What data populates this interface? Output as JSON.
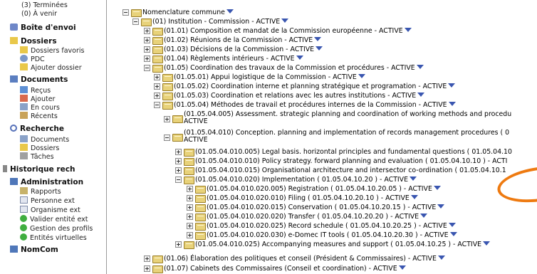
{
  "sidebar": {
    "status_lines": [
      "(3) Terminées",
      "(0) À venir"
    ],
    "boite_envoi": "Boîte d'envoi",
    "dossiers": {
      "title": "Dossiers",
      "items": [
        "Dossiers favoris",
        "PDC",
        "Ajouter dossier"
      ]
    },
    "documents": {
      "title": "Documents",
      "items": [
        "Reçus",
        "Ajouter",
        "En cours",
        "Récents"
      ]
    },
    "recherche": {
      "title": "Recherche",
      "items": [
        "Documents",
        "Dossiers",
        "Tâches"
      ]
    },
    "historique": "Historique rech",
    "administration": {
      "title": "Administration",
      "items": [
        "Rapports",
        "Personne ext",
        "Organisme ext",
        "Valider entité ext",
        "Gestion des profils",
        "Entités virtuelles"
      ]
    },
    "nomcom": "NomCom"
  },
  "tree": [
    {
      "label": "Nomenclature commune",
      "status": ""
    },
    {
      "label": "(01) Institution - Commission - ACTIVE"
    },
    {
      "label": "(01.01) Composition et mandat de la Commission européenne - ACTIVE"
    },
    {
      "label": "(01.02) Réunions de la Commission - ACTIVE"
    },
    {
      "label": "(01.03) Décisions de la Commission - ACTIVE"
    },
    {
      "label": "(01.04) Règlements intérieurs - ACTIVE"
    },
    {
      "label": "(01.05) Coordination des travaux de la Commission et procédures - ACTIVE"
    },
    {
      "label": "(01.05.01) Appui logistique de la Commission - ACTIVE"
    },
    {
      "label": "(01.05.02) Coordination interne et planning stratégique et programation - ACTIVE"
    },
    {
      "label": "(01.05.03) Coordination et relations avec les autres institutions - ACTIVE"
    },
    {
      "label": "(01.05.04) Méthodes de travail et procédures internes de la Commission - ACTIVE"
    },
    {
      "label": "(01.05.04.005) Assessment. strategic planning and coordination of working methods and procedu",
      "label2": "ACTIVE"
    },
    {
      "label": "(01.05.04.010) Conception. planning and implementation of records management procedures ( 0",
      "label2": "ACTIVE"
    },
    {
      "label": "(01.05.04.010.005) Legal basis. horizontal principles and fundamental questions ( 01.05.04.10"
    },
    {
      "label": "(01.05.04.010.010) Policy strategy. forward planning and evaluation ( 01.05.04.10.10 ) - ACTI"
    },
    {
      "label": "(01.05.04.010.015) Organisational architecture and intersector co-ordination ( 01.05.04.10.1"
    },
    {
      "label": "(01.05.04.010.020) Implementation ( 01.05.04.10.20 ) - ACTIVE"
    },
    {
      "label": "(01.05.04.010.020.005) Registration ( 01.05.04.10.20.05 ) - ACTIVE"
    },
    {
      "label": "(01.05.04.010.020.010) Filing ( 01.05.04.10.20.10 ) - ACTIVE"
    },
    {
      "label": "(01.05.04.010.020.015) Conservation ( 01.05.04.10.20.15 ) - ACTIVE"
    },
    {
      "label": "(01.05.04.010.020.020) Transfer ( 01.05.04.10.20.20 ) - ACTIVE"
    },
    {
      "label": "(01.05.04.010.020.025) Record schedule ( 01.05.04.10.20.25 ) - ACTIVE"
    },
    {
      "label": "(01.05.04.010.020.030) e-Domec IT tools ( 01.05.04.10.20.30 ) - ACTIVE"
    },
    {
      "label": "(01.05.04.010.025) Accompanying measures and support ( 01.05.04.10.25 ) - ACTIVE"
    },
    {
      "label": "(01.06) Élaboration des politiques et conseil (Président & Commissaires) - ACTIVE"
    },
    {
      "label": "(01.07) Cabinets des Commissaires (Conseil et coordination) - ACTIVE"
    }
  ],
  "colors": {
    "annotation": "#ee7a10",
    "caret": "#3a56b0",
    "folder": "#e8d27a"
  }
}
